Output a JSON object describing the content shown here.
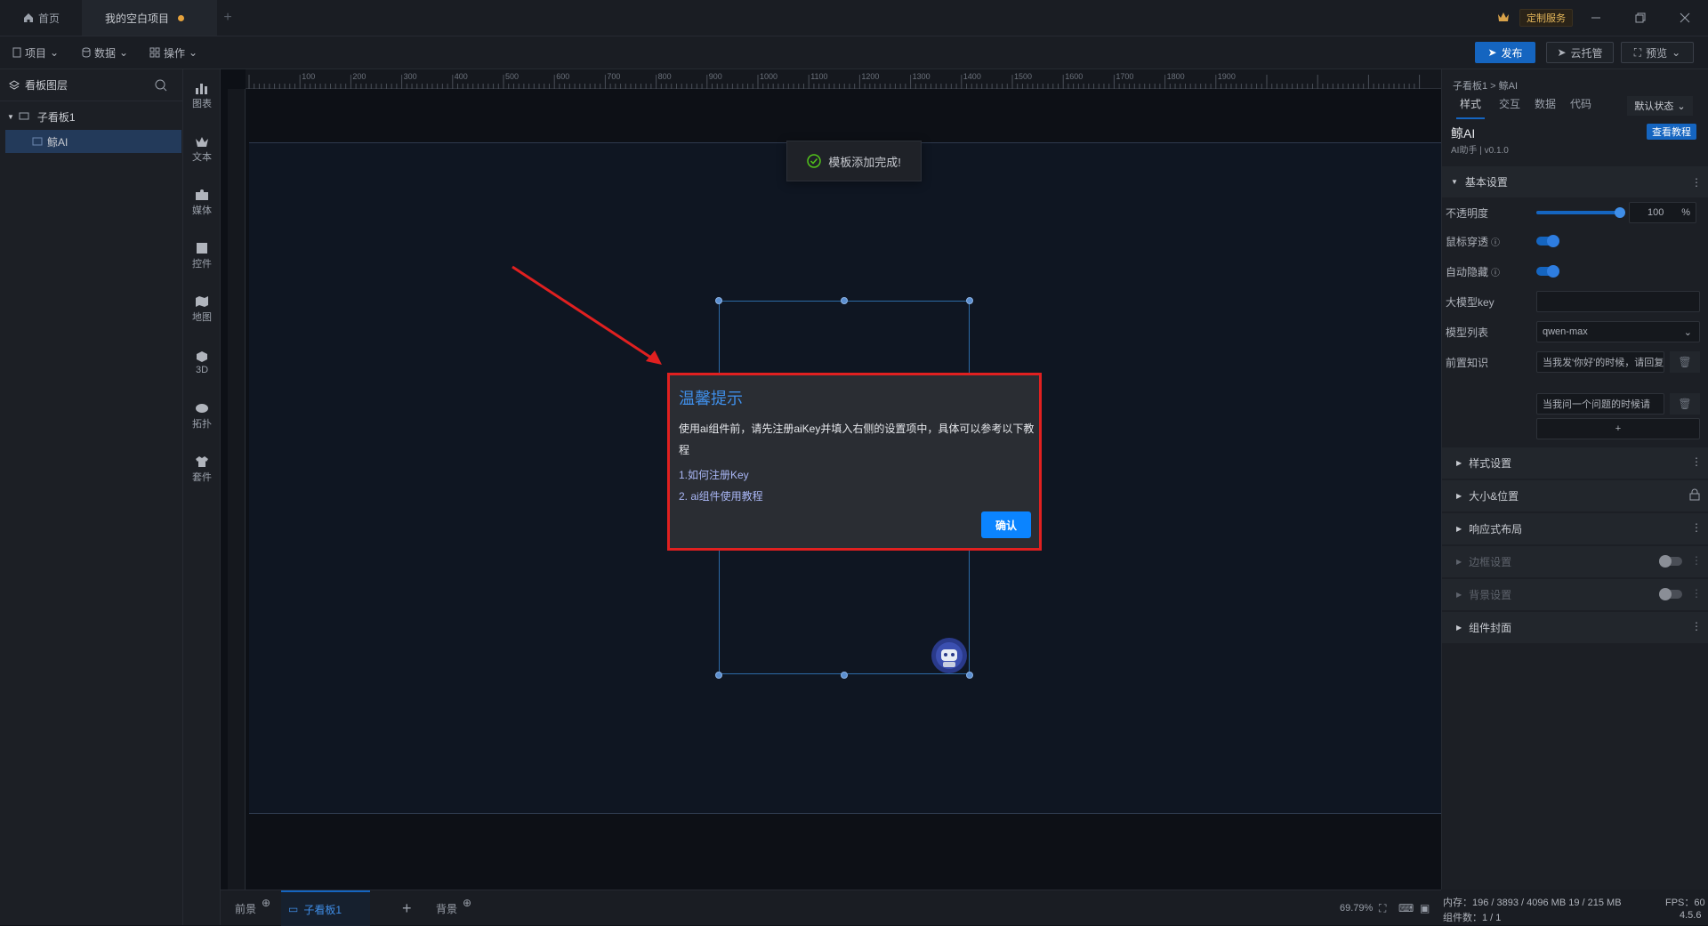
{
  "titlebar": {
    "home_tab": "首页",
    "project_tab": "我的空白项目",
    "custom_service": "定制服务"
  },
  "menubar": {
    "project": "项目",
    "data": "数据",
    "operation": "操作",
    "publish": "发布",
    "cloud_hosting": "云托管",
    "preview": "预览"
  },
  "left_panel": {
    "title": "看板图层",
    "tree": [
      {
        "label": "子看板1"
      },
      {
        "label": "鲸AI"
      }
    ]
  },
  "icon_bar": [
    "图表",
    "文本",
    "媒体",
    "控件",
    "地图",
    "3D",
    "拓扑",
    "套件"
  ],
  "ruler_ticks": [
    "100",
    "200",
    "300",
    "400",
    "500",
    "600",
    "700",
    "800",
    "900",
    "1000",
    "1100",
    "1200",
    "1300",
    "1400",
    "1500",
    "1600",
    "1700",
    "1800",
    "1900"
  ],
  "toast": "模板添加完成!",
  "dialog": {
    "title": "温馨提示",
    "message": "使用ai组件前，请先注册aiKey并填入右侧的设置项中，具体可以参考以下教程",
    "link1": "1.如何注册Key",
    "link2": "2. ai组件使用教程",
    "confirm": "确认"
  },
  "bottom": {
    "foreground": "前景",
    "board_tab": "子看板1",
    "background": "背景",
    "zoom": "69.79%"
  },
  "right_panel": {
    "breadcrumb": "子看板1 > 鲸AI",
    "tabs": [
      "样式",
      "交互",
      "数据",
      "代码"
    ],
    "state_select": "默认状态",
    "component_name": "鲸AI",
    "component_sub": "AI助手 | v0.1.0",
    "tutorial_btn": "查看教程",
    "basic_settings": "基本设置",
    "opacity_label": "不透明度",
    "opacity_value": "100",
    "opacity_unit": "%",
    "opacity_fraction": 1.0,
    "mouse_through": "鼠标穿透",
    "auto_hide": "自动隐藏",
    "model_key": "大模型key",
    "model_list_label": "模型列表",
    "model_value": "qwen-max",
    "prior_knowledge": "前置知识",
    "knowledge1": "当我发'你好'的时候，请回复",
    "knowledge2": "当我问一个问题的时候请",
    "add": "+",
    "sections": [
      "样式设置",
      "大小&位置",
      "响应式布局",
      "边框设置",
      "背景设置",
      "组件封面"
    ]
  },
  "status": {
    "memory": "内存：196 / 3893 / 4096 MB  19 / 215 MB",
    "fps": "FPS：60",
    "components": "组件数：1 / 1",
    "version": "4.5.6"
  },
  "colors": {
    "accent": "#1565c0",
    "dialog_border": "#e02020",
    "link": "#a9b6f5"
  }
}
